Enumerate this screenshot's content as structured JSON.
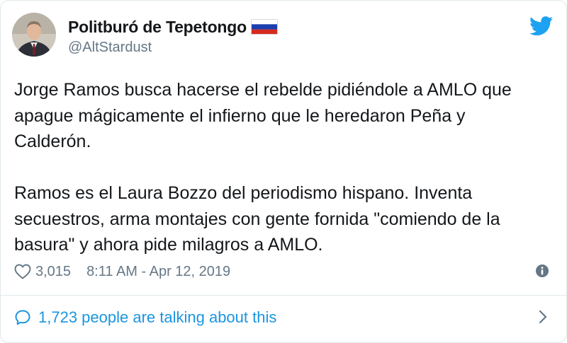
{
  "tweet": {
    "display_name": "Politburó de Tepetongo",
    "handle": "@AltStardust",
    "text": "Jorge Ramos busca hacerse el rebelde pidiéndole a AMLO que\napague mágicamente el infierno que le heredaron Peña y\nCalderón.\n\nRamos es el Laura Bozzo del periodismo hispano. Inventa\nsecuestros, arma montajes con gente fornida \"comiendo de la\nbasura\" y ahora pide milagros a AMLO.",
    "likes": "3,015",
    "timestamp": "8:11 AM - Apr 12, 2019",
    "talking": "1,723 people are talking about this"
  },
  "icons": {
    "logo": "twitter-bird-icon",
    "flag": "russia-flag-icon",
    "like": "heart-icon",
    "info": "info-icon",
    "reply": "speech-bubble-icon",
    "more": "chevron-right-icon"
  },
  "colors": {
    "brand": "#1da1f2",
    "link": "#1b95e0",
    "text": "#14171a",
    "secondary": "#657786",
    "border": "#e1e8ed"
  }
}
